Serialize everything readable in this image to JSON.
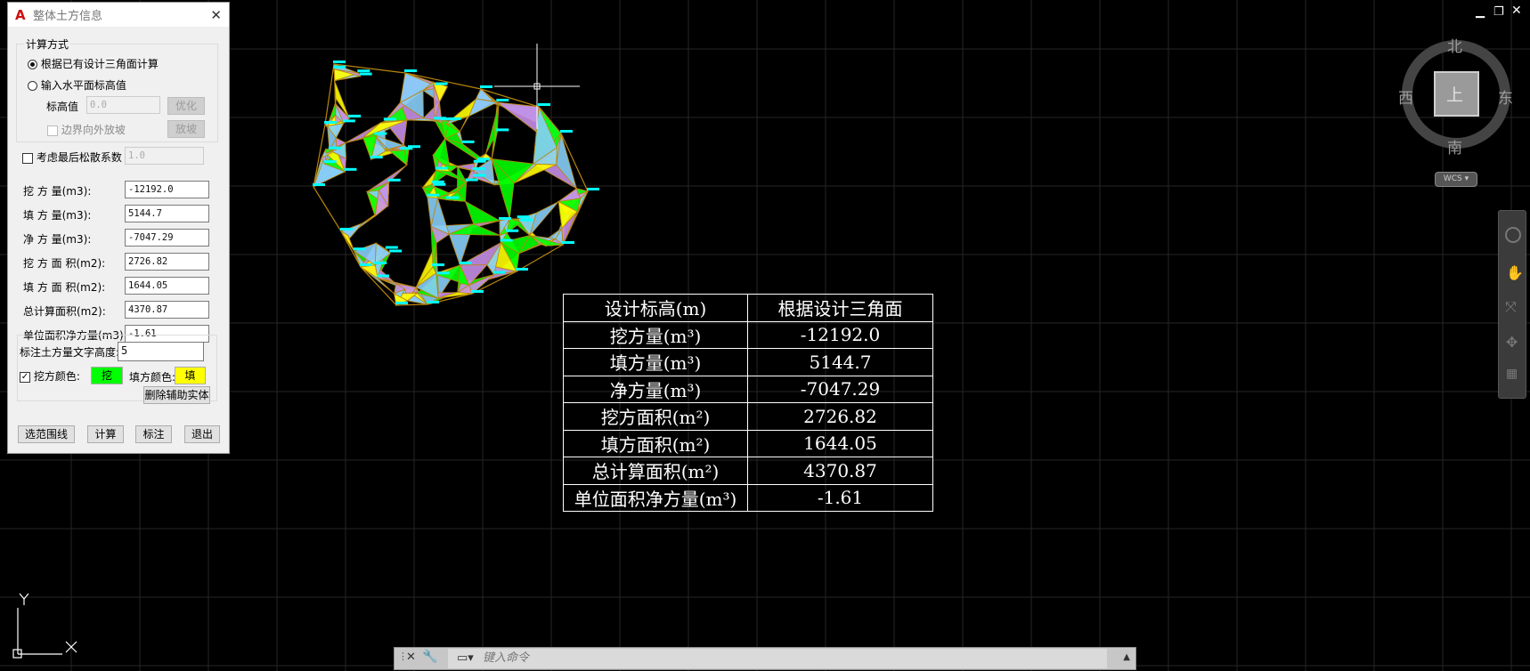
{
  "dialog": {
    "title": "整体土方信息",
    "calc_method_group": "计算方式",
    "radio_design_tin": "根据已有设计三角面计算",
    "radio_input_plane": "输入水平面标高值",
    "elevation_label": "标高值",
    "elevation_value": "0.0",
    "optimize_button": "优化",
    "slope_out_label": "边界向外放坡",
    "slope_button": "放坡",
    "loose_factor_label": "考虑最后松散系数",
    "loose_factor_value": "1.0",
    "results": [
      {
        "label": "挖  方  量(m3):",
        "value": "-12192.0"
      },
      {
        "label": "填  方  量(m3):",
        "value": "5144.7"
      },
      {
        "label": "净  方  量(m3):",
        "value": "-7047.29"
      },
      {
        "label": "挖 方 面 积(m2):",
        "value": "2726.82"
      },
      {
        "label": "填 方 面 积(m2):",
        "value": "1644.05"
      },
      {
        "label": "总计算面积(m2):",
        "value": "4370.87"
      },
      {
        "label": "单位面积净方量(m3):",
        "value": "-1.61"
      }
    ],
    "text_height_label": "标注土方量文字高度:",
    "text_height_value": "5",
    "cut_color_label": "挖方颜色:",
    "cut_color_text": "挖",
    "fill_color_label": "填方颜色:",
    "fill_color_text": "填",
    "delete_aux_button": "删除辅助实体",
    "select_boundary_button": "选范围线",
    "calc_button": "计算",
    "annotate_button": "标注",
    "exit_button": "退出"
  },
  "colors": {
    "cut": "#00ff00",
    "fill": "#ffff00",
    "tin_edge": "#b8860b",
    "label": "#00ffff",
    "tin_purple": "#c78ee8",
    "tin_blue": "#87cefa"
  },
  "result_table": {
    "rows": [
      [
        "设计标高(m)",
        "根据设计三角面"
      ],
      [
        "挖方量(m³)",
        "-12192.0"
      ],
      [
        "填方量(m³)",
        "5144.7"
      ],
      [
        "净方量(m³)",
        "-7047.29"
      ],
      [
        "挖方面积(m²)",
        "2726.82"
      ],
      [
        "填方面积(m²)",
        "1644.05"
      ],
      [
        "总计算面积(m²)",
        "4370.87"
      ],
      [
        "单位面积净方量(m³)",
        "-1.61"
      ]
    ]
  },
  "viewcube": {
    "north": "北",
    "south": "南",
    "east": "东",
    "west": "西",
    "face": "上",
    "wcs": "WCS"
  },
  "ucs": {
    "x": "X",
    "y": "Y"
  },
  "command_line": {
    "placeholder": "键入命令"
  }
}
